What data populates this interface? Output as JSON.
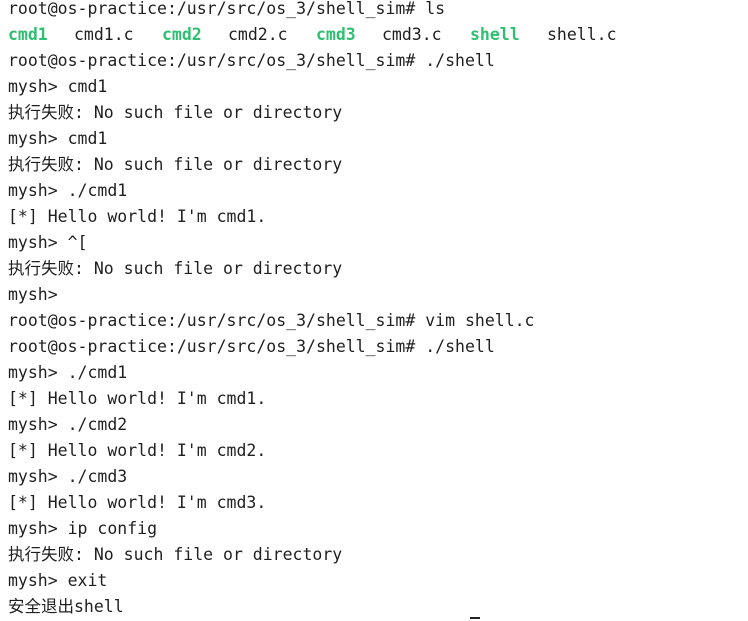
{
  "terminal": {
    "lines": [
      {
        "text": "root@os-practice:/usr/src/os_3/shell_sim# ls"
      },
      {
        "ls": [
          {
            "name": "cmd1",
            "type": "exec"
          },
          {
            "name": "cmd1.c",
            "type": "file"
          },
          {
            "name": "cmd2",
            "type": "exec"
          },
          {
            "name": "cmd2.c",
            "type": "file"
          },
          {
            "name": "cmd3",
            "type": "exec"
          },
          {
            "name": "cmd3.c",
            "type": "file"
          },
          {
            "name": "shell",
            "type": "exec"
          },
          {
            "name": "shell.c",
            "type": "file"
          }
        ]
      },
      {
        "text": "root@os-practice:/usr/src/os_3/shell_sim# ./shell"
      },
      {
        "text": "mysh> cmd1"
      },
      {
        "text": "执行失败: No such file or directory"
      },
      {
        "text": "mysh> cmd1"
      },
      {
        "text": "执行失败: No such file or directory"
      },
      {
        "text": "mysh> ./cmd1"
      },
      {
        "text": "[*] Hello world! I'm cmd1."
      },
      {
        "text": "mysh> ^["
      },
      {
        "text": "执行失败: No such file or directory"
      },
      {
        "text": "mysh>"
      },
      {
        "text": "root@os-practice:/usr/src/os_3/shell_sim# vim shell.c"
      },
      {
        "text": "root@os-practice:/usr/src/os_3/shell_sim# ./shell"
      },
      {
        "text": "mysh> ./cmd1"
      },
      {
        "text": "[*] Hello world! I'm cmd1."
      },
      {
        "text": "mysh> ./cmd2"
      },
      {
        "text": "[*] Hello world! I'm cmd2."
      },
      {
        "text": "mysh> ./cmd3"
      },
      {
        "text": "[*] Hello world! I'm cmd3."
      },
      {
        "text": "mysh> ip config"
      },
      {
        "text": "执行失败: No such file or directory"
      },
      {
        "text": "mysh> exit"
      },
      {
        "text": "安全退出shell"
      }
    ]
  },
  "colors": {
    "background": "#ffffff",
    "text": "#1f1f1f",
    "executable": "#2fbf71"
  }
}
